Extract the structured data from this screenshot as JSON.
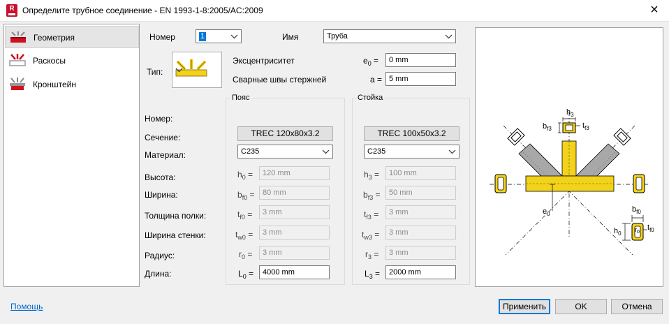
{
  "window": {
    "title": "Определите трубное соединение - EN 1993-1-8:2005/AC:2009",
    "app_icon_letter": "R"
  },
  "nav": {
    "items": [
      {
        "label": "Геометрия",
        "icon": "chord-geometry-icon",
        "selected": true
      },
      {
        "label": "Раскосы",
        "icon": "braces-icon",
        "selected": false
      },
      {
        "label": "Кронштейн",
        "icon": "bracket-icon",
        "selected": false
      }
    ]
  },
  "header": {
    "number_label": "Номер",
    "number_value": "1",
    "name_label": "Имя",
    "name_value": "Труба",
    "type_label": "Тип:",
    "type_icon": "k-joint-type-icon"
  },
  "eccentricity": {
    "label": "Эксцентриситет",
    "symbol": "e",
    "sub": "0",
    "eq": "=",
    "value": "0 mm"
  },
  "welds": {
    "label": "Сварные швы стержней",
    "symbol": "a",
    "eq": "=",
    "value": "5 mm"
  },
  "groups": {
    "chord_title": "Пояс",
    "post_title": "Стойка"
  },
  "rows": {
    "number": "Номер:",
    "section": "Сечение:",
    "material": "Материал:",
    "height": "Высота:",
    "width": "Ширина:",
    "flange_thickness": "Толщина полки:",
    "web_thickness": "Ширина стенки:",
    "radius": "Радиус:",
    "length": "Длина:"
  },
  "chord": {
    "section": "TREC 120x80x3.2",
    "material": "C235",
    "h": {
      "sym": "h",
      "sub": "0",
      "value": "120 mm"
    },
    "b": {
      "sym": "b",
      "sub": "f0",
      "value": "80 mm"
    },
    "tf": {
      "sym": "t",
      "sub": "f0",
      "value": "3 mm"
    },
    "tw": {
      "sym": "t",
      "sub": "w0",
      "value": "3 mm"
    },
    "r": {
      "sym": "r",
      "sub": "0",
      "value": "3 mm"
    },
    "L": {
      "sym": "L",
      "sub": "0",
      "value": "4000 mm"
    }
  },
  "post": {
    "section": "TREC 100x50x3.2",
    "material": "C235",
    "h": {
      "sym": "h",
      "sub": "3",
      "value": "100 mm"
    },
    "b": {
      "sym": "b",
      "sub": "f3",
      "value": "50 mm"
    },
    "tf": {
      "sym": "t",
      "sub": "f3",
      "value": "3 mm"
    },
    "tw": {
      "sym": "t",
      "sub": "w3",
      "value": "3 mm"
    },
    "r": {
      "sym": "r",
      "sub": "3",
      "value": "3 mm"
    },
    "L": {
      "sym": "L",
      "sub": "3",
      "value": "2000 mm"
    }
  },
  "eq_sign": "=",
  "preview": {
    "labels": {
      "h3": {
        "s": "h",
        "sub": "3"
      },
      "bf3": {
        "s": "b",
        "sub": "f3"
      },
      "tf3": {
        "s": "t",
        "sub": "f3"
      },
      "e0": {
        "s": "e",
        "sub": "0"
      },
      "bf0": {
        "s": "b",
        "sub": "f0"
      },
      "h0": {
        "s": "h",
        "sub": "0"
      },
      "r0": {
        "s": "r",
        "sub": "0"
      },
      "tf0": {
        "s": "t",
        "sub": "f0"
      }
    },
    "colors": {
      "chord": "#f2d21b",
      "brace": "#a8a8a8",
      "outline": "#000000"
    }
  },
  "footer": {
    "help": "Помощь",
    "apply": "Применить",
    "ok": "OK",
    "cancel": "Отмена"
  }
}
